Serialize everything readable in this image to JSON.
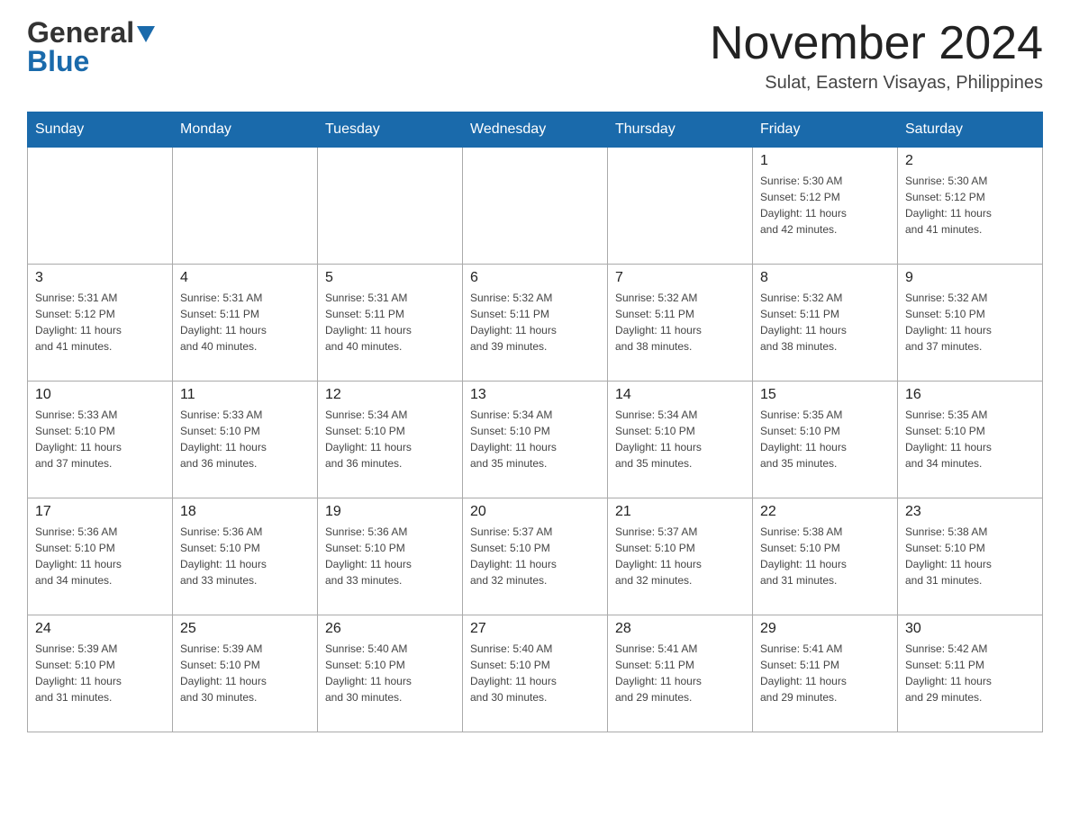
{
  "header": {
    "logo_general": "General",
    "logo_blue": "Blue",
    "month_title": "November 2024",
    "subtitle": "Sulat, Eastern Visayas, Philippines"
  },
  "days_of_week": [
    "Sunday",
    "Monday",
    "Tuesday",
    "Wednesday",
    "Thursday",
    "Friday",
    "Saturday"
  ],
  "weeks": [
    [
      {
        "day": "",
        "info": ""
      },
      {
        "day": "",
        "info": ""
      },
      {
        "day": "",
        "info": ""
      },
      {
        "day": "",
        "info": ""
      },
      {
        "day": "",
        "info": ""
      },
      {
        "day": "1",
        "info": "Sunrise: 5:30 AM\nSunset: 5:12 PM\nDaylight: 11 hours\nand 42 minutes."
      },
      {
        "day": "2",
        "info": "Sunrise: 5:30 AM\nSunset: 5:12 PM\nDaylight: 11 hours\nand 41 minutes."
      }
    ],
    [
      {
        "day": "3",
        "info": "Sunrise: 5:31 AM\nSunset: 5:12 PM\nDaylight: 11 hours\nand 41 minutes."
      },
      {
        "day": "4",
        "info": "Sunrise: 5:31 AM\nSunset: 5:11 PM\nDaylight: 11 hours\nand 40 minutes."
      },
      {
        "day": "5",
        "info": "Sunrise: 5:31 AM\nSunset: 5:11 PM\nDaylight: 11 hours\nand 40 minutes."
      },
      {
        "day": "6",
        "info": "Sunrise: 5:32 AM\nSunset: 5:11 PM\nDaylight: 11 hours\nand 39 minutes."
      },
      {
        "day": "7",
        "info": "Sunrise: 5:32 AM\nSunset: 5:11 PM\nDaylight: 11 hours\nand 38 minutes."
      },
      {
        "day": "8",
        "info": "Sunrise: 5:32 AM\nSunset: 5:11 PM\nDaylight: 11 hours\nand 38 minutes."
      },
      {
        "day": "9",
        "info": "Sunrise: 5:32 AM\nSunset: 5:10 PM\nDaylight: 11 hours\nand 37 minutes."
      }
    ],
    [
      {
        "day": "10",
        "info": "Sunrise: 5:33 AM\nSunset: 5:10 PM\nDaylight: 11 hours\nand 37 minutes."
      },
      {
        "day": "11",
        "info": "Sunrise: 5:33 AM\nSunset: 5:10 PM\nDaylight: 11 hours\nand 36 minutes."
      },
      {
        "day": "12",
        "info": "Sunrise: 5:34 AM\nSunset: 5:10 PM\nDaylight: 11 hours\nand 36 minutes."
      },
      {
        "day": "13",
        "info": "Sunrise: 5:34 AM\nSunset: 5:10 PM\nDaylight: 11 hours\nand 35 minutes."
      },
      {
        "day": "14",
        "info": "Sunrise: 5:34 AM\nSunset: 5:10 PM\nDaylight: 11 hours\nand 35 minutes."
      },
      {
        "day": "15",
        "info": "Sunrise: 5:35 AM\nSunset: 5:10 PM\nDaylight: 11 hours\nand 35 minutes."
      },
      {
        "day": "16",
        "info": "Sunrise: 5:35 AM\nSunset: 5:10 PM\nDaylight: 11 hours\nand 34 minutes."
      }
    ],
    [
      {
        "day": "17",
        "info": "Sunrise: 5:36 AM\nSunset: 5:10 PM\nDaylight: 11 hours\nand 34 minutes."
      },
      {
        "day": "18",
        "info": "Sunrise: 5:36 AM\nSunset: 5:10 PM\nDaylight: 11 hours\nand 33 minutes."
      },
      {
        "day": "19",
        "info": "Sunrise: 5:36 AM\nSunset: 5:10 PM\nDaylight: 11 hours\nand 33 minutes."
      },
      {
        "day": "20",
        "info": "Sunrise: 5:37 AM\nSunset: 5:10 PM\nDaylight: 11 hours\nand 32 minutes."
      },
      {
        "day": "21",
        "info": "Sunrise: 5:37 AM\nSunset: 5:10 PM\nDaylight: 11 hours\nand 32 minutes."
      },
      {
        "day": "22",
        "info": "Sunrise: 5:38 AM\nSunset: 5:10 PM\nDaylight: 11 hours\nand 31 minutes."
      },
      {
        "day": "23",
        "info": "Sunrise: 5:38 AM\nSunset: 5:10 PM\nDaylight: 11 hours\nand 31 minutes."
      }
    ],
    [
      {
        "day": "24",
        "info": "Sunrise: 5:39 AM\nSunset: 5:10 PM\nDaylight: 11 hours\nand 31 minutes."
      },
      {
        "day": "25",
        "info": "Sunrise: 5:39 AM\nSunset: 5:10 PM\nDaylight: 11 hours\nand 30 minutes."
      },
      {
        "day": "26",
        "info": "Sunrise: 5:40 AM\nSunset: 5:10 PM\nDaylight: 11 hours\nand 30 minutes."
      },
      {
        "day": "27",
        "info": "Sunrise: 5:40 AM\nSunset: 5:10 PM\nDaylight: 11 hours\nand 30 minutes."
      },
      {
        "day": "28",
        "info": "Sunrise: 5:41 AM\nSunset: 5:11 PM\nDaylight: 11 hours\nand 29 minutes."
      },
      {
        "day": "29",
        "info": "Sunrise: 5:41 AM\nSunset: 5:11 PM\nDaylight: 11 hours\nand 29 minutes."
      },
      {
        "day": "30",
        "info": "Sunrise: 5:42 AM\nSunset: 5:11 PM\nDaylight: 11 hours\nand 29 minutes."
      }
    ]
  ]
}
